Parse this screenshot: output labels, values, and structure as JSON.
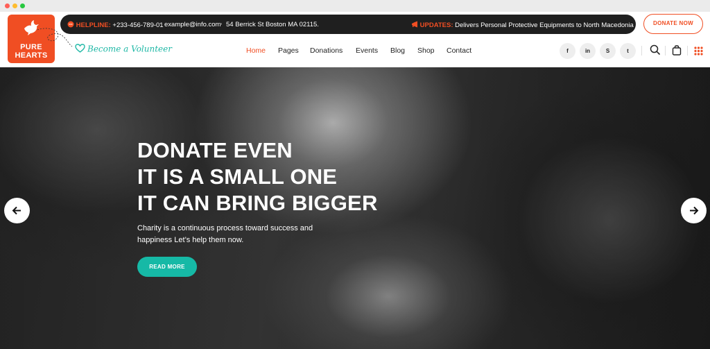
{
  "colors": {
    "brand": "#f04e23",
    "accent": "#16b9a6",
    "topbar": "#1f1f1f"
  },
  "logo": {
    "line1": "PURE",
    "line2": "HEARTS",
    "icon": "dove-icon"
  },
  "infobar": {
    "helpline_label": "HELPLINE:",
    "helpline_number": "+233-456-789-01",
    "email": "example@info.com",
    "address": "54 Berrick St Boston MA 02115.",
    "updates_label": "UPDATES:",
    "updates_text": "Delivers Personal Protective Equipments to North Macedonia . . ."
  },
  "donate_button": "DONATE NOW",
  "volunteer_link": "Become a Volunteer",
  "nav": {
    "home": "Home",
    "pages": "Pages",
    "donations": "Donations",
    "events": "Events",
    "blog": "Blog",
    "shop": "Shop",
    "contact": "Contact",
    "active": "Home"
  },
  "social": {
    "facebook": "f",
    "linkedin": "in",
    "skype": "S",
    "twitter": "t"
  },
  "hero": {
    "title_line1": "DONATE EVEN",
    "title_line2": "IT IS A SMALL ONE",
    "title_line3": "IT CAN BRING BIGGER",
    "subtitle": "Charity is a continuous process toward success and happiness Let’s help them now.",
    "cta": "READ MORE"
  }
}
